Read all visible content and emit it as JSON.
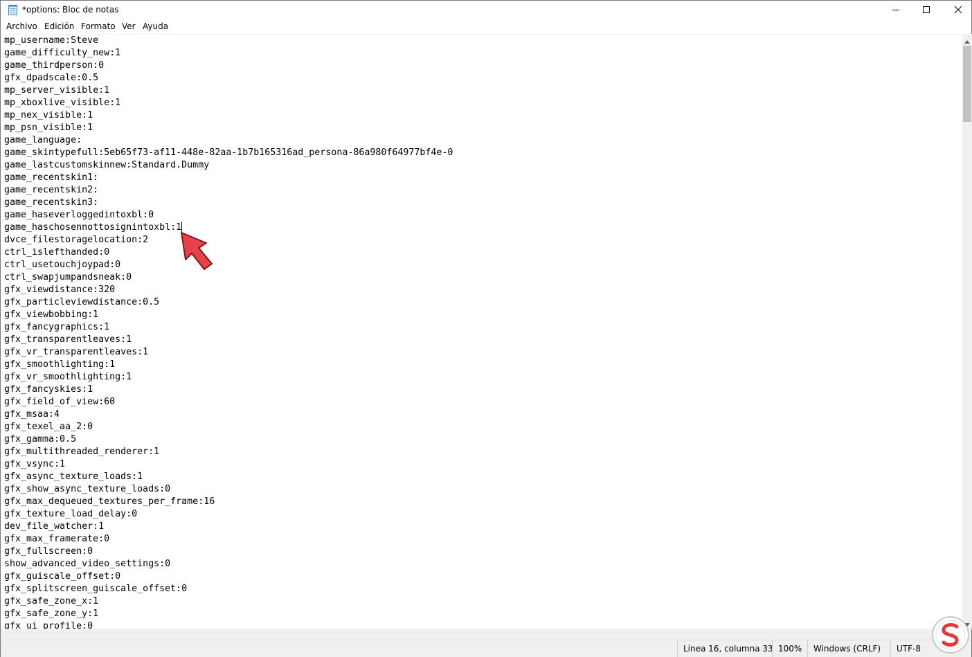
{
  "window": {
    "title": "*options: Bloc de notas",
    "app_icon": "notepad-icon"
  },
  "caption_buttons": {
    "minimize_icon": "minimize-icon",
    "maximize_icon": "maximize-icon",
    "close_icon": "close-icon"
  },
  "menu": [
    "Archivo",
    "Edición",
    "Formato",
    "Ver",
    "Ayuda"
  ],
  "editor": {
    "lines": [
      "mp_username:Steve",
      "game_difficulty_new:1",
      "game_thirdperson:0",
      "gfx_dpadscale:0.5",
      "mp_server_visible:1",
      "mp_xboxlive_visible:1",
      "mp_nex_visible:1",
      "mp_psn_visible:1",
      "game_language:",
      "game_skintypefull:5eb65f73-af11-448e-82aa-1b7b165316ad_persona-86a980f64977bf4e-0",
      "game_lastcustomskinnew:Standard.Dummy",
      "game_recentskin1:",
      "game_recentskin2:",
      "game_recentskin3:",
      "game_haseverloggedintoxbl:0",
      "game_haschosennottosignintoxbl:1",
      "dvce_filestoragelocation:2",
      "ctrl_islefthanded:0",
      "ctrl_usetouchjoypad:0",
      "ctrl_swapjumpandsneak:0",
      "gfx_viewdistance:320",
      "gfx_particleviewdistance:0.5",
      "gfx_viewbobbing:1",
      "gfx_fancygraphics:1",
      "gfx_transparentleaves:1",
      "gfx_vr_transparentleaves:1",
      "gfx_smoothlighting:1",
      "gfx_vr_smoothlighting:1",
      "gfx_fancyskies:1",
      "gfx_field_of_view:60",
      "gfx_msaa:4",
      "gfx_texel_aa_2:0",
      "gfx_gamma:0.5",
      "gfx_multithreaded_renderer:1",
      "gfx_vsync:1",
      "gfx_async_texture_loads:1",
      "gfx_show_async_texture_loads:0",
      "gfx_max_dequeued_textures_per_frame:16",
      "gfx_texture_load_delay:0",
      "dev_file_watcher:1",
      "gfx_max_framerate:0",
      "gfx_fullscreen:0",
      "show_advanced_video_settings:0",
      "gfx_guiscale_offset:0",
      "gfx_splitscreen_guiscale_offset:0",
      "gfx_safe_zone_x:1",
      "gfx_safe_zone_y:1",
      "gfx_ui_profile:0"
    ]
  },
  "scrollbar": {
    "up_icon": "scroll-up-arrow-icon",
    "down_icon": "scroll-down-arrow-icon"
  },
  "status": {
    "position": "Línea 16, columna 33",
    "zoom": "100%",
    "line_ending": "Windows (CRLF)",
    "encoding": "UTF-8"
  },
  "colors": {
    "annotation_arrow": "#e8414a",
    "chrome": "#f0f0f0",
    "scroll_thumb": "#c2c2c2"
  }
}
